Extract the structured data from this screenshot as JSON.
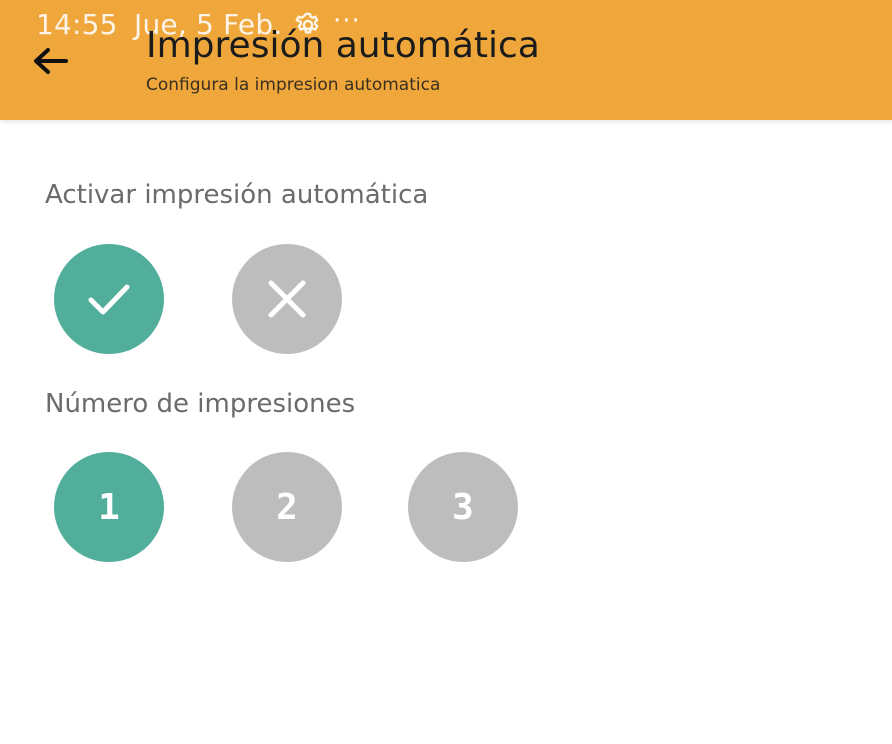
{
  "status_bar": {
    "time": "14:55",
    "date": "Jue, 5 Feb.",
    "gear_icon": "gear-icon",
    "more": "···"
  },
  "header": {
    "title": "Impresión automática",
    "subtitle": "Configura la impresion automatica",
    "background": "#efa73c"
  },
  "auto_print": {
    "label": "Activar impresión automática",
    "selected": "yes",
    "options": [
      {
        "id": "yes",
        "icon": "check-icon",
        "color": "#50ae9b"
      },
      {
        "id": "no",
        "icon": "close-icon",
        "color": "#bdbdbd"
      }
    ]
  },
  "print_count": {
    "label": "Número de impresiones",
    "selected": "1",
    "options": [
      "1",
      "2",
      "3"
    ],
    "active_color": "#50ae9b",
    "inactive_color": "#bdbdbd"
  }
}
